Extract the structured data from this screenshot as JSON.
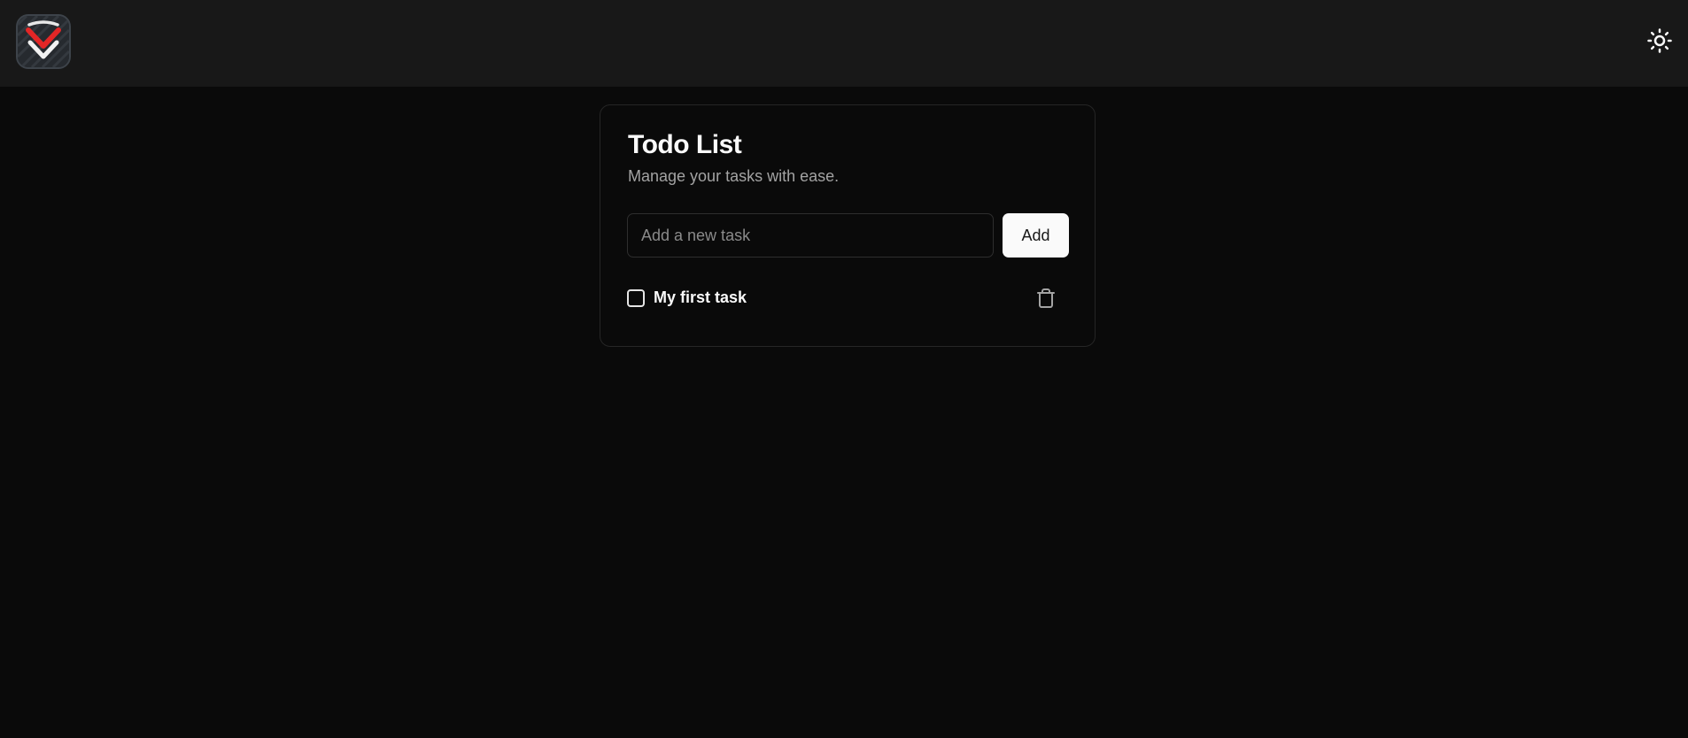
{
  "header": {
    "logo_icon": "checkmark-shield-logo",
    "theme_toggle_icon": "sun-icon"
  },
  "card": {
    "title": "Todo List",
    "subtitle": "Manage your tasks with ease.",
    "input": {
      "placeholder": "Add a new task",
      "value": ""
    },
    "add_label": "Add",
    "tasks": [
      {
        "label": "My first task",
        "checked": false,
        "delete_icon": "trash-icon"
      }
    ]
  },
  "colors": {
    "background": "#0a0a0a",
    "header": "#181818",
    "logo_accent": "#e32626",
    "button_bg": "#fafafa"
  }
}
